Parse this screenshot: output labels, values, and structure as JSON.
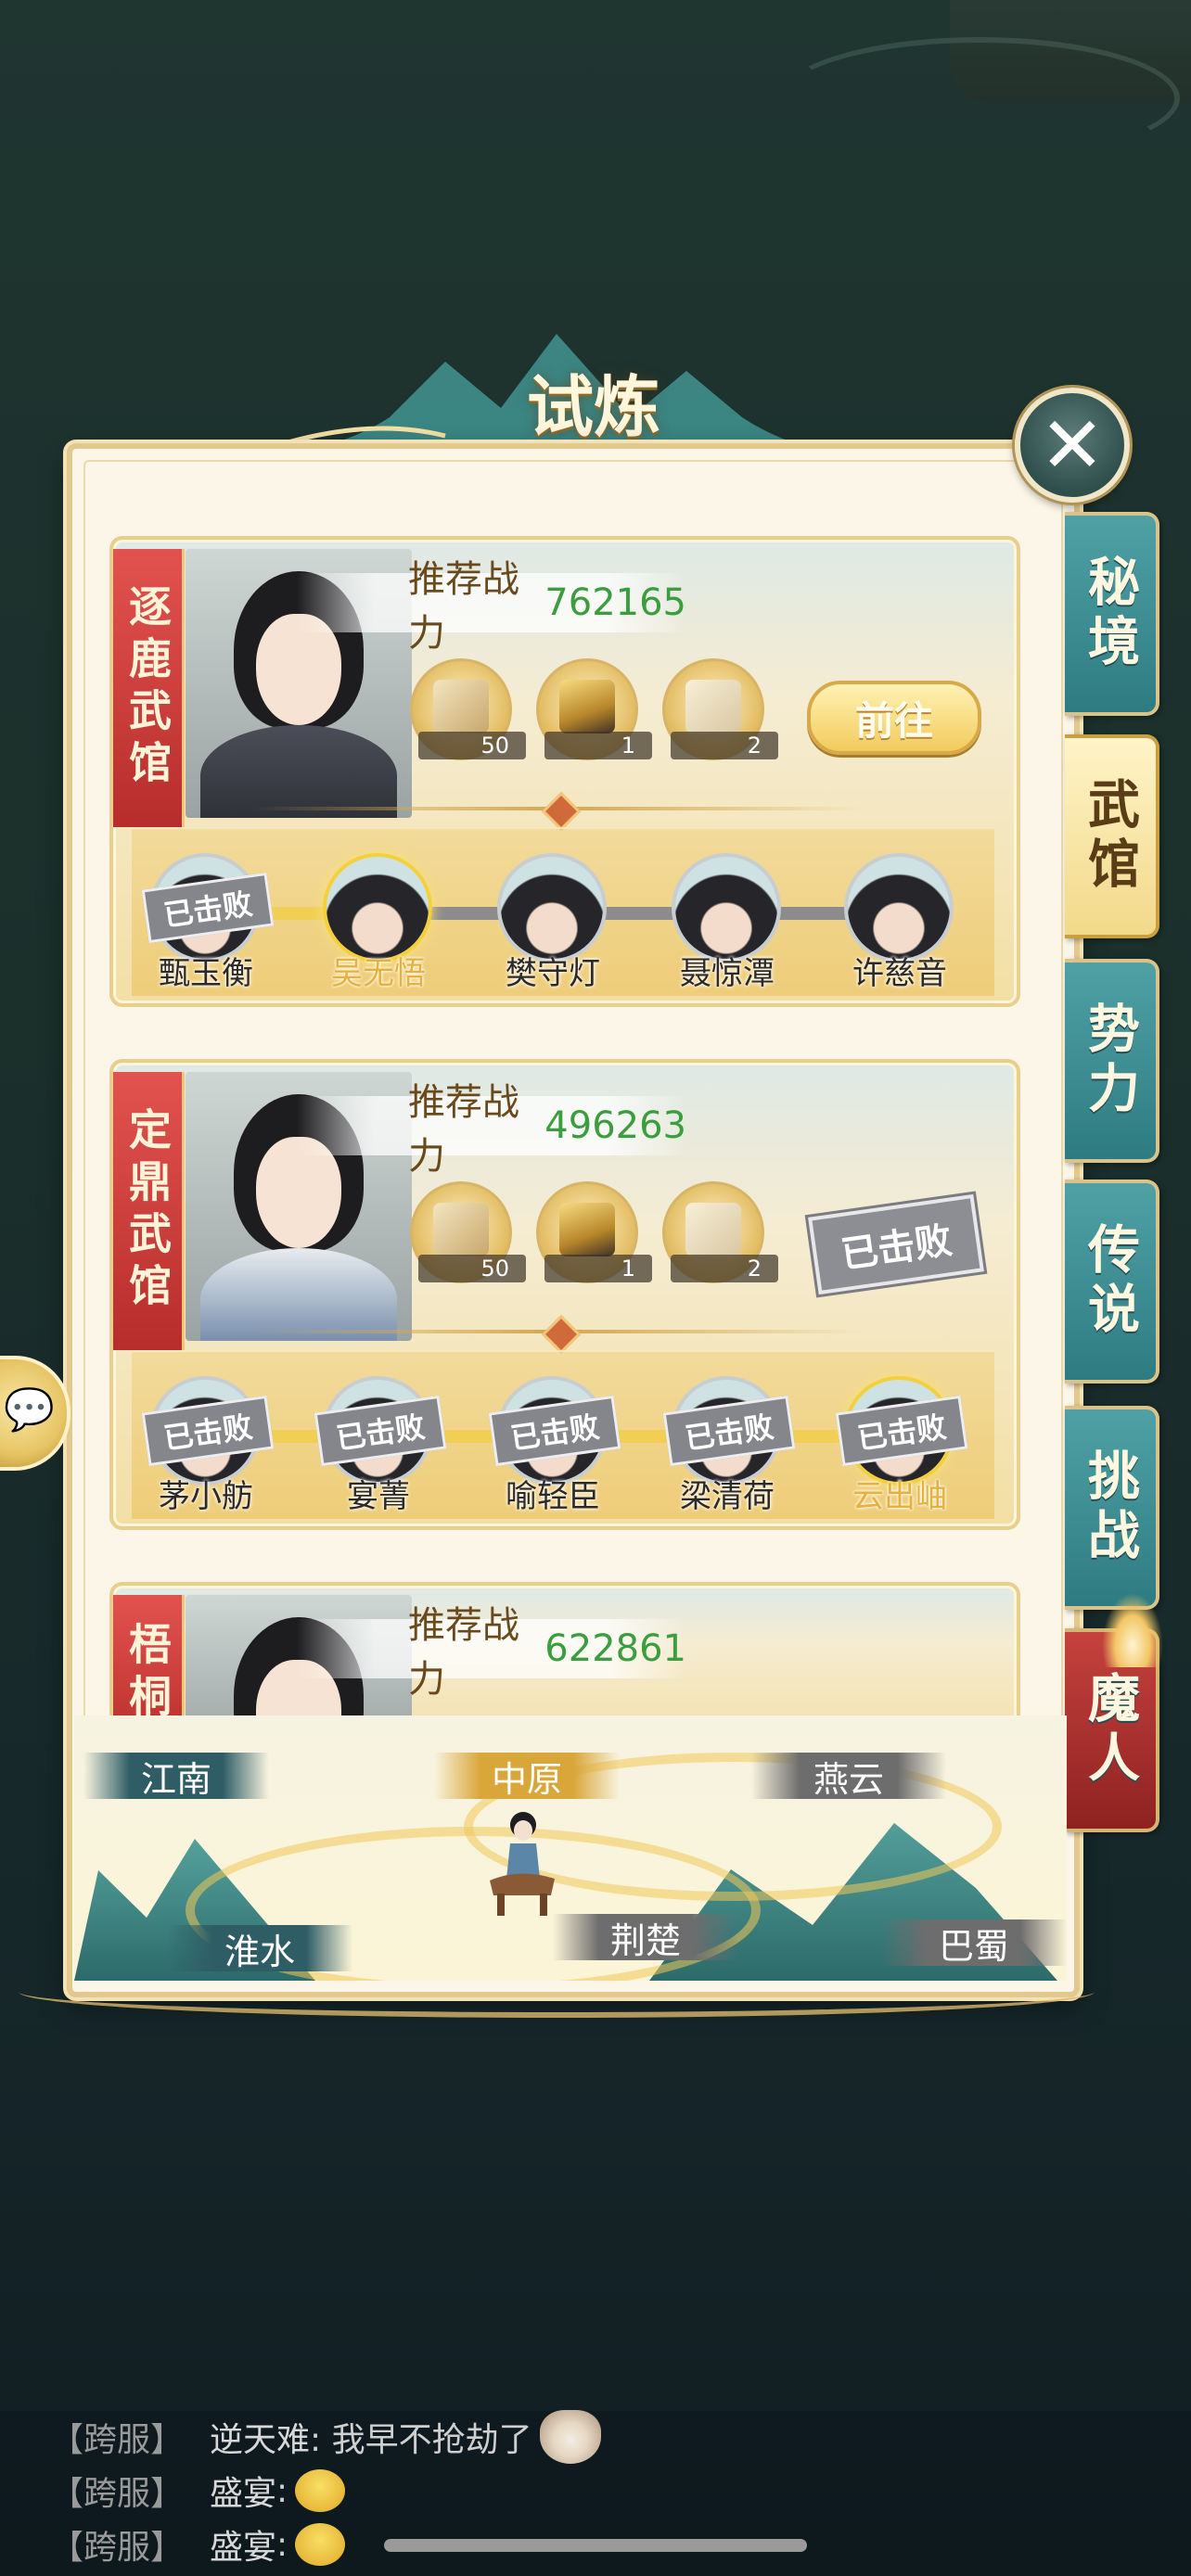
{
  "title": "试炼",
  "side_tabs": [
    {
      "label": "秘境"
    },
    {
      "label": "武馆"
    },
    {
      "label": "势力"
    },
    {
      "label": "传说"
    },
    {
      "label": "挑战"
    },
    {
      "label": "魔人"
    }
  ],
  "cards": [
    {
      "name": "逐鹿武馆",
      "power_label": "推荐战力",
      "power_value": "762165",
      "rewards": [
        {
          "icon": "scroll-icon",
          "count": "50"
        },
        {
          "icon": "gold-ore-icon",
          "count": "1"
        },
        {
          "icon": "manual-book-icon",
          "count": "2"
        }
      ],
      "action_label": "前往",
      "opponents": [
        {
          "name": "甄玉衡",
          "stamp": "已击败"
        },
        {
          "name": "吴无悟",
          "stamp": ""
        },
        {
          "name": "樊守灯",
          "stamp": ""
        },
        {
          "name": "聂惊潭",
          "stamp": ""
        },
        {
          "name": "许慈音",
          "stamp": ""
        }
      ]
    },
    {
      "name": "定鼎武馆",
      "power_label": "推荐战力",
      "power_value": "496263",
      "rewards": [
        {
          "icon": "scroll-icon",
          "count": "50"
        },
        {
          "icon": "gold-ore-icon",
          "count": "1"
        },
        {
          "icon": "manual-book-icon",
          "count": "2"
        }
      ],
      "action_label": "已击败",
      "opponents": [
        {
          "name": "茅小舫",
          "stamp": "已击败"
        },
        {
          "name": "宴菁",
          "stamp": "已击败"
        },
        {
          "name": "喻轻臣",
          "stamp": "已击败"
        },
        {
          "name": "梁清荷",
          "stamp": "已击败"
        },
        {
          "name": "云出岫",
          "stamp": "已击败"
        }
      ]
    },
    {
      "name": "梧桐",
      "power_label": "推荐战力",
      "power_value": "622861"
    }
  ],
  "regions": {
    "jiangnan": "江南",
    "zhongyuan": "中原",
    "yanyun": "燕云",
    "huaishui": "淮水",
    "jingchu": "荆楚",
    "bashu": "巴蜀"
  },
  "chat": [
    {
      "channel": "【跨服】",
      "sender": "逆天难",
      "message": ": 我早不抢劫了",
      "emoji": "cat-emoji"
    },
    {
      "channel": "【跨服】",
      "sender": "盛宴",
      "message": ":",
      "emoji": "smile-emoji"
    },
    {
      "channel": "【跨服】",
      "sender": "盛宴",
      "message": ":",
      "emoji": "smile-emoji"
    }
  ],
  "colors": {
    "power_value": "#3a9e3e",
    "ribbon_red": "#c23a37",
    "tab_teal": "#3b8d92",
    "current_opponent": "#e6b23e"
  }
}
